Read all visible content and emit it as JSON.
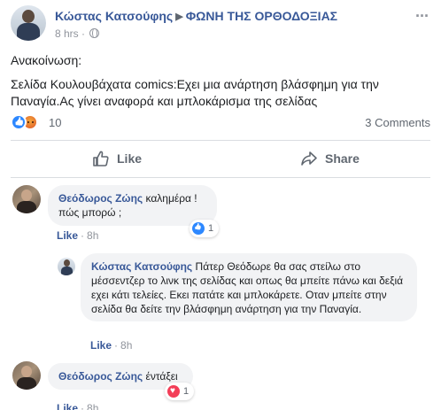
{
  "post": {
    "author": "Κώστας Κατσούφης",
    "group": "ΦΩΝΗ ΤΗΣ ΟΡΘΟΔΟΞΙΑΣ",
    "arrow_icon": "right-triangle-icon",
    "time": "8 hrs",
    "time_separator": "·",
    "privacy_icon": "globe-icon",
    "more_label": "···",
    "announcement": "Ανακοίνωση:",
    "body": "Σελίδα Κουλουβάχατα comics:Εχει μια ανάρτηση βλάσφημη για την Παναγία.Ας γίνει αναφορά και μπλοκάρισμα της σελίδας"
  },
  "reactions": {
    "icons": [
      "like-icon",
      "angry-icon"
    ],
    "count": "10",
    "comments": "3 Comments"
  },
  "actions": {
    "like": "Like",
    "share": "Share"
  },
  "comments": [
    {
      "name": "Θεόδωρος Ζώης",
      "text_line1": " καλημέρα !",
      "text_line2": "πώς μπορώ ;",
      "like": "Like",
      "time": "8h",
      "reaction_icon": "like-icon",
      "reaction_count": "1",
      "reply": {
        "name": "Κώστας Κατσούφης",
        "text": " Πάτερ Θεόδωρε θα σας στείλω στο μέσσεντζερ το λινκ της σελίδας και οπως θα μπείτε πάνω και δεξιά εχει κάτι τελείες. Εκει πατάτε και μπλοκάρετε. Οταν μπείτε στην σελίδα θα δείτε την βλάσφημη ανάρτηση για την Παναγία.",
        "like": "Like",
        "time": "8h"
      }
    },
    {
      "name": "Θεόδωρος Ζώης",
      "text": " έντάξει",
      "reaction_icon": "love-icon",
      "reaction_count": "1",
      "like": "Like",
      "time": "8h"
    }
  ],
  "colors": {
    "link_blue": "#385898",
    "meta_gray": "#90949c",
    "bubble_bg": "#f2f3f5",
    "like_blue": "#2d88ff",
    "love_red": "#f33e58"
  }
}
